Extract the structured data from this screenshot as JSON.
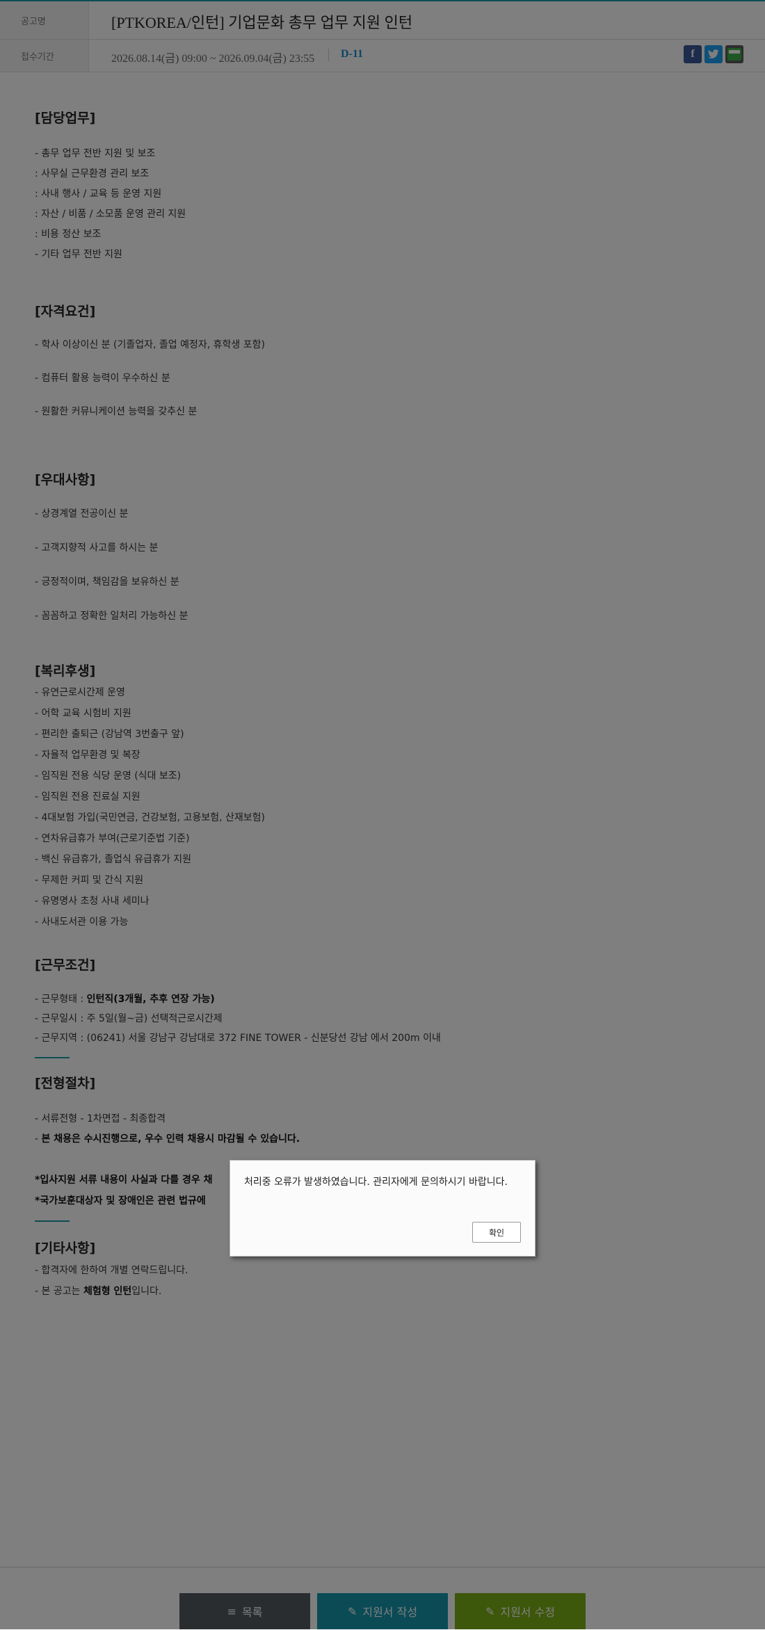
{
  "header": {
    "title_label": "공고명",
    "title": "[PTKOREA/인턴] 기업문화 총무 업무 지원 인턴",
    "period_label": "접수기간",
    "period": "2026.08.14(금) 09:00 ~ 2026.09.04(금) 23:55",
    "dday": "D-11",
    "share": {
      "facebook": "f",
      "twitter": "t"
    }
  },
  "sections": {
    "duties": {
      "heading": "[담당업무]",
      "lines": [
        "- 총무 업무 전반 지원 및 보조",
        ": 사무실 근무환경 관리 보조",
        ": 사내 행사 / 교육 등 운영 지원",
        ": 자산 / 비품 / 소모품 운영 관리 지원",
        ": 비용 정산 보조",
        "- 기타 업무 전반 지원"
      ]
    },
    "qualifications": {
      "heading": "[자격요건]",
      "lines": [
        "- 학사 이상이신 분 (기졸업자, 졸업 예정자, 휴학생 포함)",
        "- 컴퓨터 활용 능력이 우수하신 분",
        "- 원활한 커뮤니케이션 능력을 갖추신 분"
      ]
    },
    "preferred": {
      "heading": "[우대사항]",
      "lines": [
        "- 상경계열 전공이신 분",
        "- 고객지향적 사고를 하시는 분",
        "- 긍정적이며, 책임감을 보유하신 분",
        "- 꼼꼼하고 정확한 일처리 가능하신 분"
      ]
    },
    "benefits": {
      "heading": "[복리후생]",
      "lines": [
        "- 유연근로시간제 운영",
        "- 어학 교육 시험비 지원",
        "- 편리한 출퇴근 (강남역 3번출구 앞)",
        "- 자율적 업무환경 및 복장",
        "- 임직원 전용 식당 운영 (식대 보조)",
        "- 임직원 전용 진료실 지원",
        "- 4대보험 가입(국민연금, 건강보험, 고용보험, 산재보험)",
        "- 연차유급휴가 부여(근로기준법 기준)",
        "- 백신 유급휴가, 졸업식 유급휴가 지원",
        "- 무제한 커피 및 간식 지원",
        "- 유명명사 초청 사내 세미나",
        "- 사내도서관 이용 가능"
      ]
    },
    "conditions": {
      "heading": "[근무조건]",
      "type_prefix": "- 근무형태 : ",
      "type_value": "인턴직(3개월, 추후 연장 가능)",
      "hours": "- 근무일시 : 주 5일(월~금) 선택적근로시간제",
      "location": "- 근무지역 : (06241) 서울 강남구 강남대로 372 FINE TOWER - 신분당선 강남 에서 200m 이내"
    },
    "process": {
      "heading": "[전형절차]",
      "steps": "- 서류전형 - 1차면접 - 최종합격",
      "note_prefix": "- ",
      "note": "본 채용은 수시진행으로, 우수 인력 채용시 마감될 수 있습니다.",
      "warn1": "*입사지원 서류 내용이 사실과 다를 경우 채",
      "warn2": "*국가보훈대상자 및 장애인은 관련 법규에 "
    },
    "etc": {
      "heading": "[기타사항]",
      "line1": "- 합격자에 한하여 개별 연락드립니다.",
      "line2_prefix": "- 본 공고는 ",
      "line2_bold": "체험형 인턴",
      "line2_suffix": "입니다."
    }
  },
  "dialog": {
    "message": "처리중 오류가 발생하였습니다. 관리자에게 문의하시기 바랍니다.",
    "confirm": "확인"
  },
  "buttons": {
    "list": "목록",
    "write": "지원서 작성",
    "edit": "지원서 수정"
  },
  "colors": {
    "accent": "#1a9aa8",
    "dday": "#1e88c7",
    "write_button": "#1696ac",
    "edit_button": "#7bae16",
    "list_button": "#555a60"
  }
}
